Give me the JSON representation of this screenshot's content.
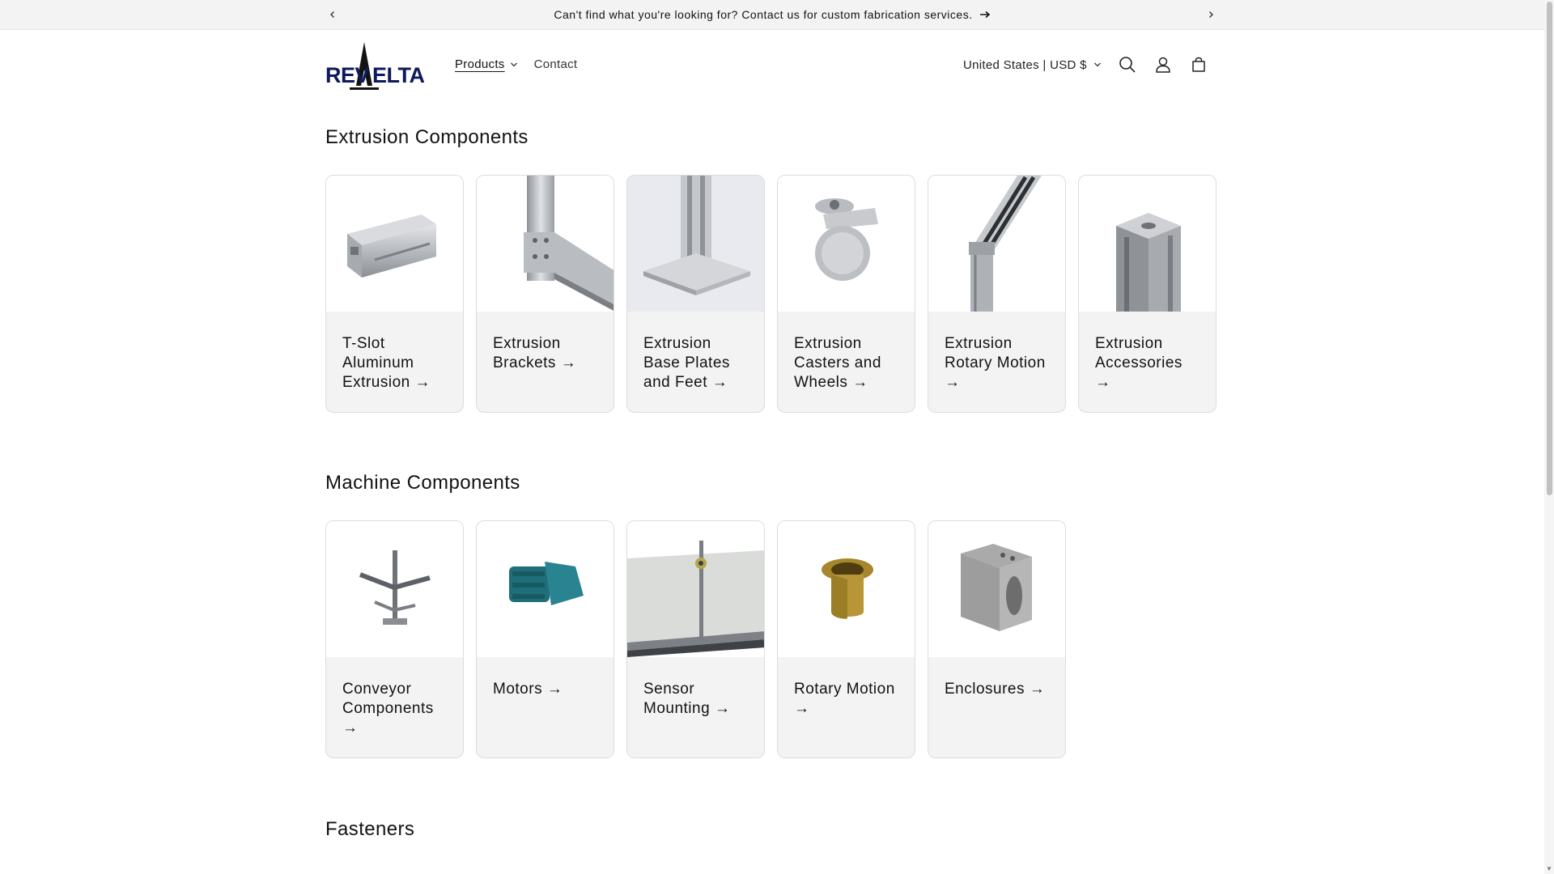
{
  "announcement": {
    "message": "Can't find what you're looking for? Contact us for custom fabrication services."
  },
  "header": {
    "logo_text": "REVDELTA",
    "nav": [
      {
        "label": "Products"
      },
      {
        "label": "Contact"
      }
    ],
    "country_selector": "United States | USD $",
    "icons": [
      "search-icon",
      "account-icon",
      "cart-icon"
    ]
  },
  "sections": [
    {
      "title": "Extrusion Components",
      "cards": [
        {
          "label": "T-Slot Aluminum Extrusion →"
        },
        {
          "label": "Extrusion Brackets →"
        },
        {
          "label": "Extrusion Base Plates and Feet →"
        },
        {
          "label": "Extrusion Casters and Wheels →"
        },
        {
          "label": "Extrusion Rotary Motion →"
        },
        {
          "label": "Extrusion Accessories →"
        }
      ]
    },
    {
      "title": "Machine Components",
      "cards": [
        {
          "label": "Conveyor Components →"
        },
        {
          "label": "Motors →"
        },
        {
          "label": "Sensor Mounting →"
        },
        {
          "label": "Rotary Motion →"
        },
        {
          "label": "Enclosures →"
        }
      ]
    },
    {
      "title": "Fasteners"
    }
  ]
}
